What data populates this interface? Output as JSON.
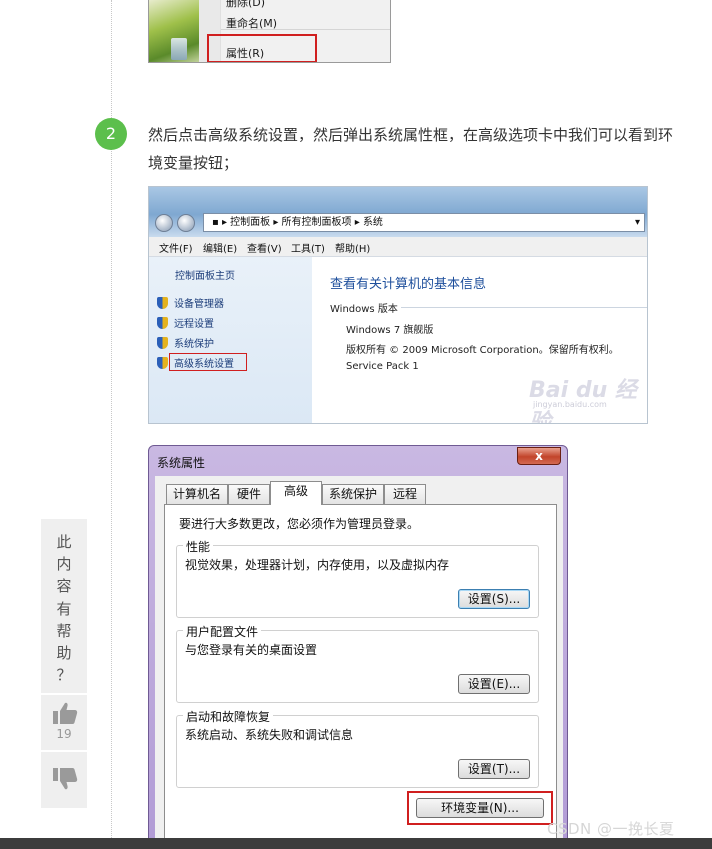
{
  "top_menu": {
    "items": [
      "删除(D)",
      "重命名(M)",
      "属性(R)"
    ]
  },
  "step": {
    "number": "2",
    "text": "然后点击高级系统设置，然后弹出系统属性框，在高级选项卡中我们可以看到环境变量按钮；"
  },
  "control_panel": {
    "breadcrumb": [
      "控制面板",
      "所有控制面板项",
      "系统"
    ],
    "menus": [
      "文件(F)",
      "编辑(E)",
      "查看(V)",
      "工具(T)",
      "帮助(H)"
    ],
    "home_link": "控制面板主页",
    "side_links": [
      "设备管理器",
      "远程设置",
      "系统保护",
      "高级系统设置"
    ],
    "main_title": "查看有关计算机的基本信息",
    "group_label": "Windows 版本",
    "edition": "Windows 7 旗舰版",
    "copyright": "版权所有 © 2009 Microsoft Corporation。保留所有权利。",
    "service_pack": "Service Pack 1",
    "watermark": "Bai du 经验",
    "watermark_url": "jingyan.baidu.com"
  },
  "dialog": {
    "title": "系统属性",
    "close_label": "x",
    "tabs": [
      "计算机名",
      "硬件",
      "高级",
      "系统保护",
      "远程"
    ],
    "active_tab": "高级",
    "admin_note": "要进行大多数更改，您必须作为管理员登录。",
    "groups": [
      {
        "title": "性能",
        "desc": "视觉效果，处理器计划，内存使用，以及虚拟内存",
        "button": "设置(S)..."
      },
      {
        "title": "用户配置文件",
        "desc": "与您登录有关的桌面设置",
        "button": "设置(E)..."
      },
      {
        "title": "启动和故障恢复",
        "desc": "系统启动、系统失败和调试信息",
        "button": "设置(T)..."
      }
    ],
    "env_button": "环境变量(N)..."
  },
  "feedback": {
    "question": [
      "此",
      "内",
      "容",
      "有",
      "帮",
      "助",
      "？"
    ],
    "like_count": "19",
    "up_icon": "thumbs-up-icon",
    "down_icon": "thumbs-down-icon"
  },
  "watermark_csdn": "CSDN @一挽长夏",
  "colors": {
    "step_badge": "#5cbf4c",
    "highlight_box": "#d01f1f",
    "link_blue": "#1e4f9c"
  }
}
